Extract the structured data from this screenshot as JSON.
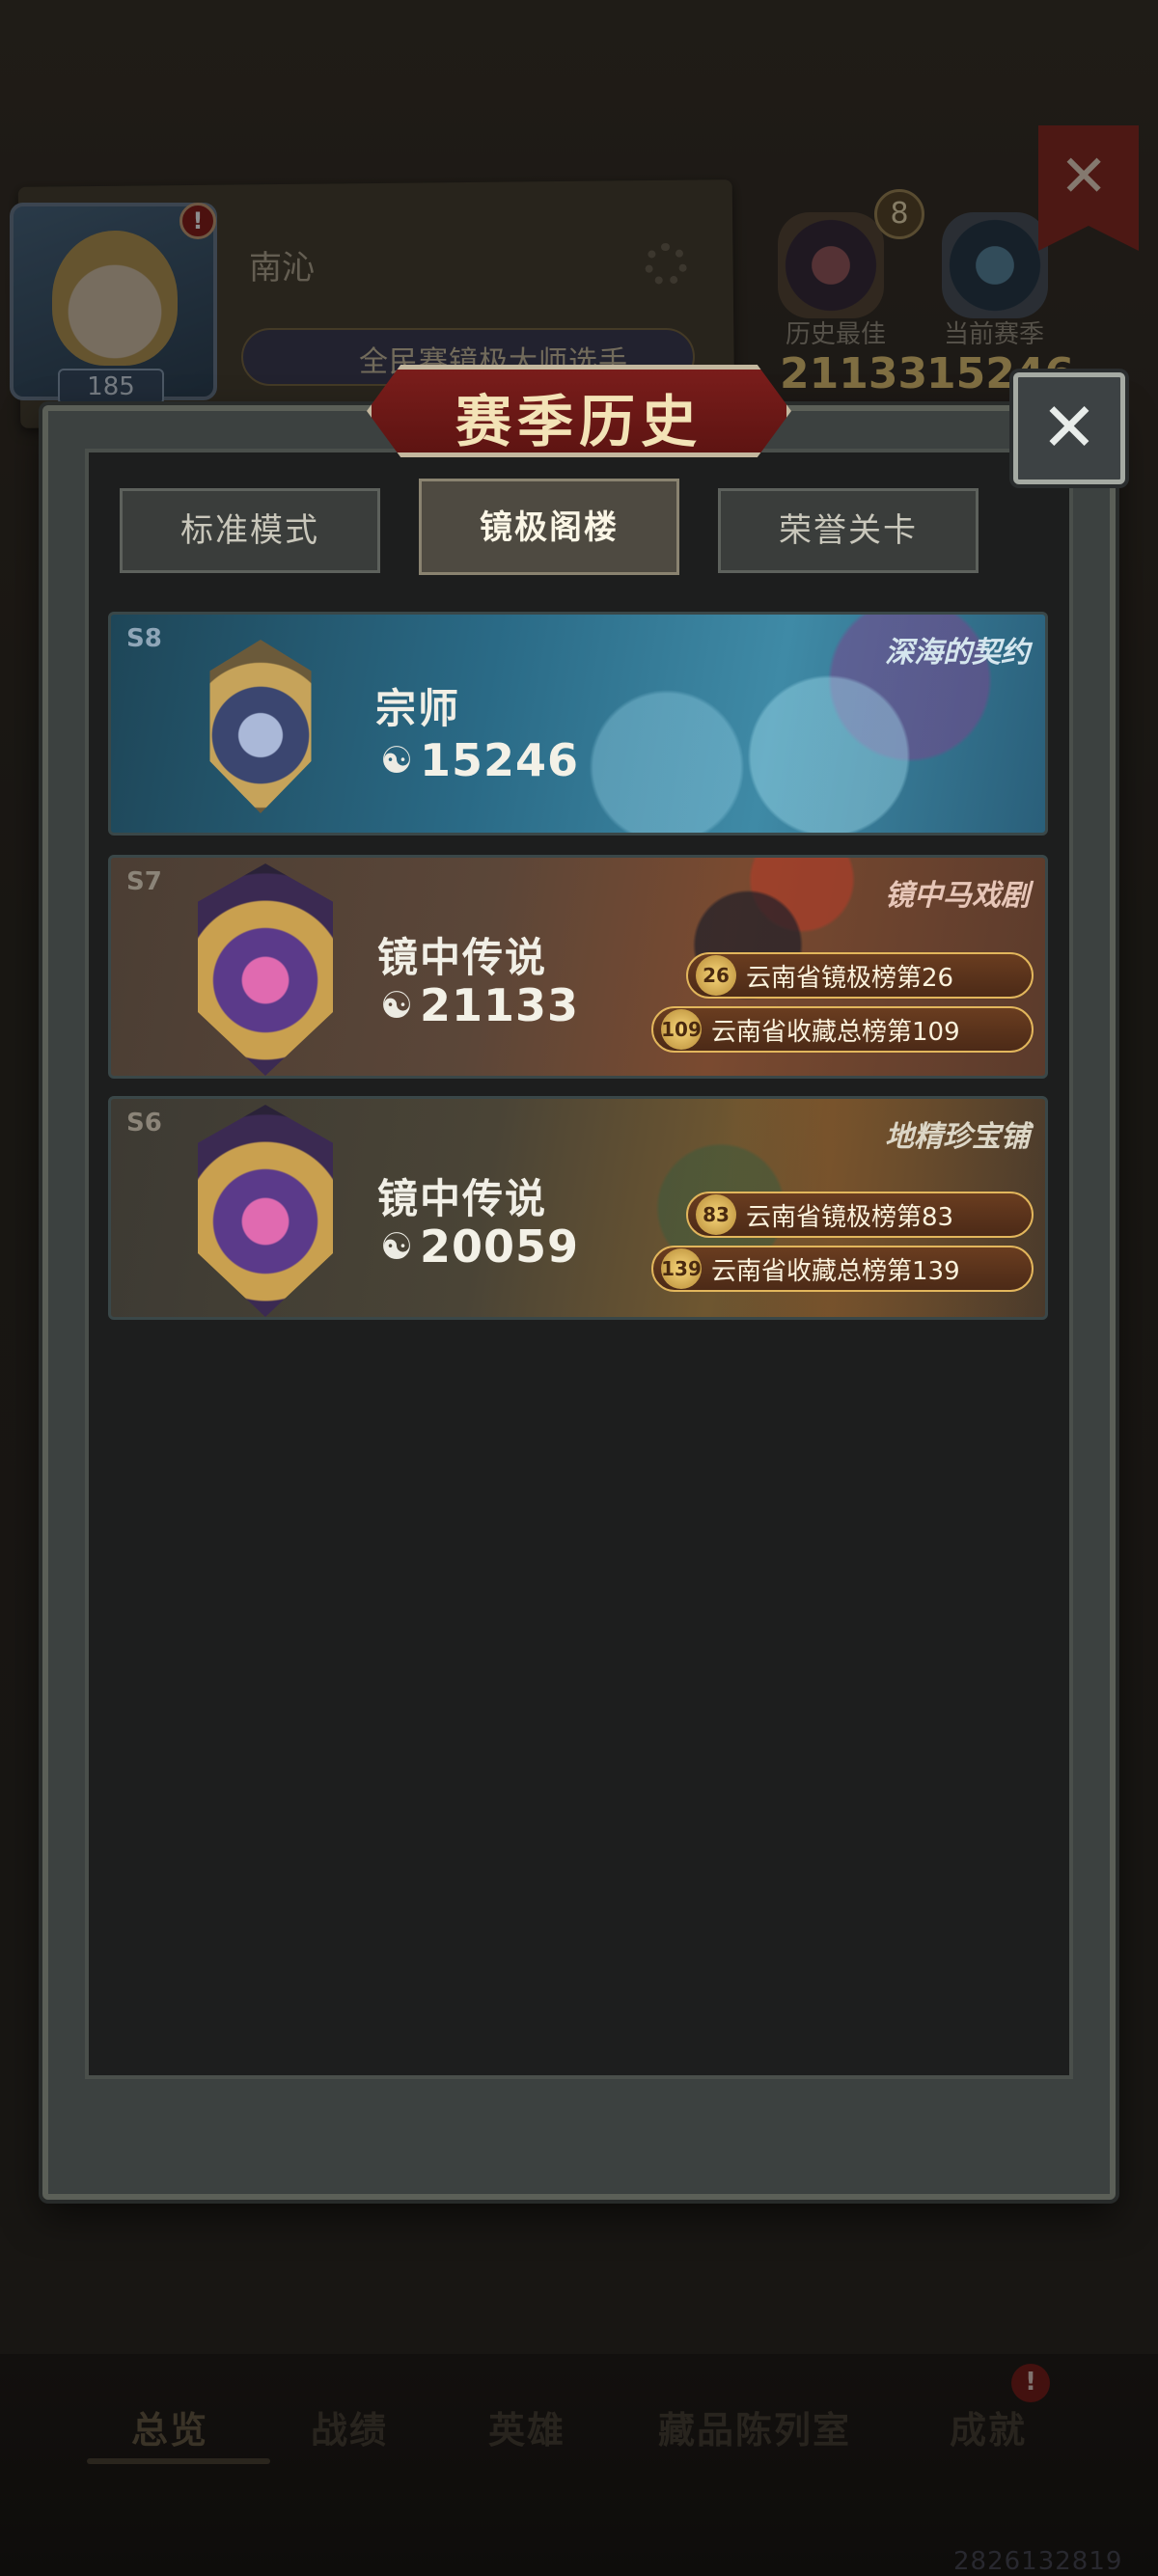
{
  "background": {
    "player_name": "南沁",
    "level": "185",
    "title_banner": "全民赛镜极大师选手",
    "avatar_alert": "!",
    "best_label": "历史最佳",
    "best_value": "21133",
    "best_count": "8",
    "current_label": "当前赛季",
    "current_value": "15246",
    "nav": [
      "总览",
      "战绩",
      "英雄",
      "藏品陈列室",
      "成就"
    ],
    "nav_alert": "!",
    "uid": "2826132819"
  },
  "modal": {
    "title": "赛季历史",
    "close_symbol": "✕",
    "tabs": [
      {
        "label": "标准模式",
        "active": false
      },
      {
        "label": "镜极阁楼",
        "active": true
      },
      {
        "label": "荣誉关卡",
        "active": false
      }
    ],
    "score_icon": "☯",
    "seasons": [
      {
        "tag": "S8",
        "name": "深海的契约",
        "rank": "宗师",
        "score": "15246",
        "rankings": []
      },
      {
        "tag": "S7",
        "name": "镜中马戏剧",
        "rank": "镜中传说",
        "score": "21133",
        "rankings": [
          {
            "num": "26",
            "text": "云南省镜极榜第26"
          },
          {
            "num": "109",
            "text": "云南省收藏总榜第109"
          }
        ]
      },
      {
        "tag": "S6",
        "name": "地精珍宝铺",
        "rank": "镜中传说",
        "score": "20059",
        "rankings": [
          {
            "num": "83",
            "text": "云南省镜极榜第83"
          },
          {
            "num": "139",
            "text": "云南省收藏总榜第139"
          }
        ]
      }
    ]
  },
  "colors": {
    "modal_title_bg": "#6d1a18",
    "gold_accent": "#e2b65c",
    "stat_gold": "#e8c878"
  },
  "icons": {
    "close": "close-icon",
    "gear": "gear-icon",
    "score": "spiral-icon",
    "rank_emblem": "rank-emblem-icon"
  }
}
